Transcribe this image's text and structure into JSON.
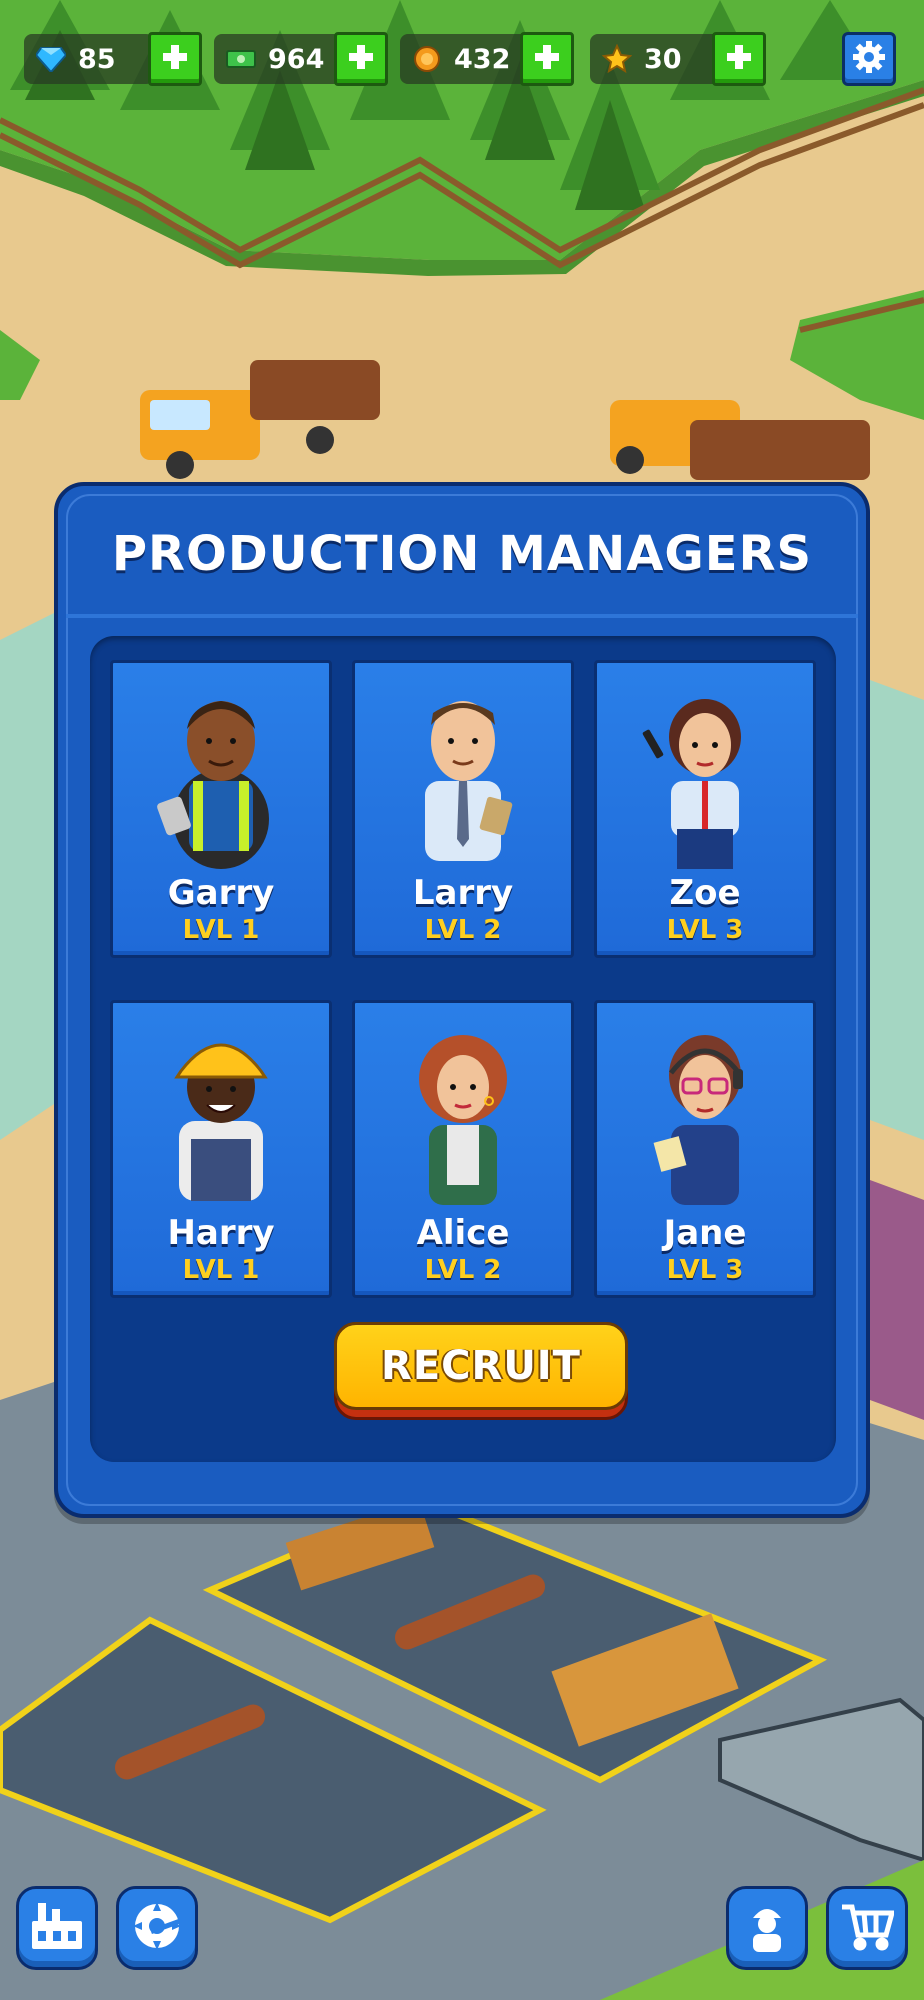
{
  "resources": [
    {
      "id": "gems",
      "icon": "diamond-icon",
      "value": "85"
    },
    {
      "id": "cash",
      "icon": "cash-icon",
      "value": "964"
    },
    {
      "id": "coins",
      "icon": "coin-icon",
      "value": "432"
    },
    {
      "id": "stars",
      "icon": "star-icon",
      "value": "30"
    }
  ],
  "modal": {
    "title": "PRODUCTION MANAGERS",
    "recruit_label": "RECRUIT"
  },
  "managers": [
    {
      "name": "Garry",
      "level": "LVL 1",
      "role": "worker-vest"
    },
    {
      "name": "Larry",
      "level": "LVL 2",
      "role": "office-tie"
    },
    {
      "name": "Zoe",
      "level": "LVL 3",
      "role": "office-radio"
    },
    {
      "name": "Harry",
      "level": "LVL 1",
      "role": "hardhat-worker"
    },
    {
      "name": "Alice",
      "level": "LVL 2",
      "role": "office-redhead"
    },
    {
      "name": "Jane",
      "level": "LVL 3",
      "role": "headset-glasses"
    }
  ],
  "bottom_nav": [
    {
      "id": "factory",
      "icon": "factory-icon"
    },
    {
      "id": "saw",
      "icon": "saw-blade-icon"
    },
    {
      "id": "workers",
      "icon": "worker-icon"
    },
    {
      "id": "shop",
      "icon": "cart-icon"
    }
  ],
  "colors": {
    "plus_button": "#3ccf1e",
    "modal_bg": "#1a5cc0",
    "card_bg": "#2a7fe8",
    "level_text": "#ffcf1f",
    "recruit_button": "#ffc20a"
  }
}
